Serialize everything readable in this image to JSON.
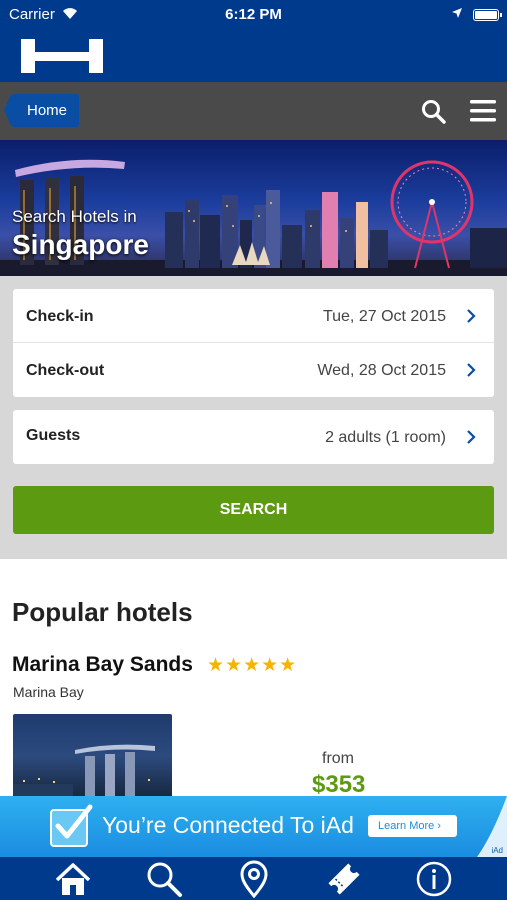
{
  "status_bar": {
    "carrier": "Carrier",
    "time": "6:12 PM"
  },
  "header": {
    "logo_icon": "hotels-h-logo"
  },
  "nav": {
    "home_label": "Home",
    "search_icon": "search-icon",
    "menu_icon": "hamburger-menu-icon"
  },
  "hero": {
    "subtitle": "Search Hotels in",
    "city": "Singapore"
  },
  "form": {
    "rows": [
      {
        "label": "Check-in",
        "value": "Tue, 27 Oct 2015"
      },
      {
        "label": "Check-out",
        "value": "Wed, 28 Oct 2015"
      },
      {
        "label": "Guests",
        "value": "2 adults (1 room)"
      }
    ],
    "search_label": "SEARCH"
  },
  "popular": {
    "title": "Popular hotels",
    "hotel": {
      "name": "Marina Bay Sands",
      "stars": "★★★★★",
      "rating": 5,
      "area": "Marina Bay",
      "from_label": "from",
      "price": "$353"
    }
  },
  "ad": {
    "text": "You’re Connected To iAd",
    "button": "Learn More ›",
    "badge": "iAd"
  },
  "tabbar": {
    "tabs": [
      "home-icon",
      "search-icon",
      "location-pin-icon",
      "ticket-icon",
      "info-icon"
    ]
  },
  "colors": {
    "brand_blue": "#003a8c",
    "nav_gray": "#4a4a4a",
    "accent_green": "#5c9a12",
    "star_gold": "#f5b400"
  }
}
